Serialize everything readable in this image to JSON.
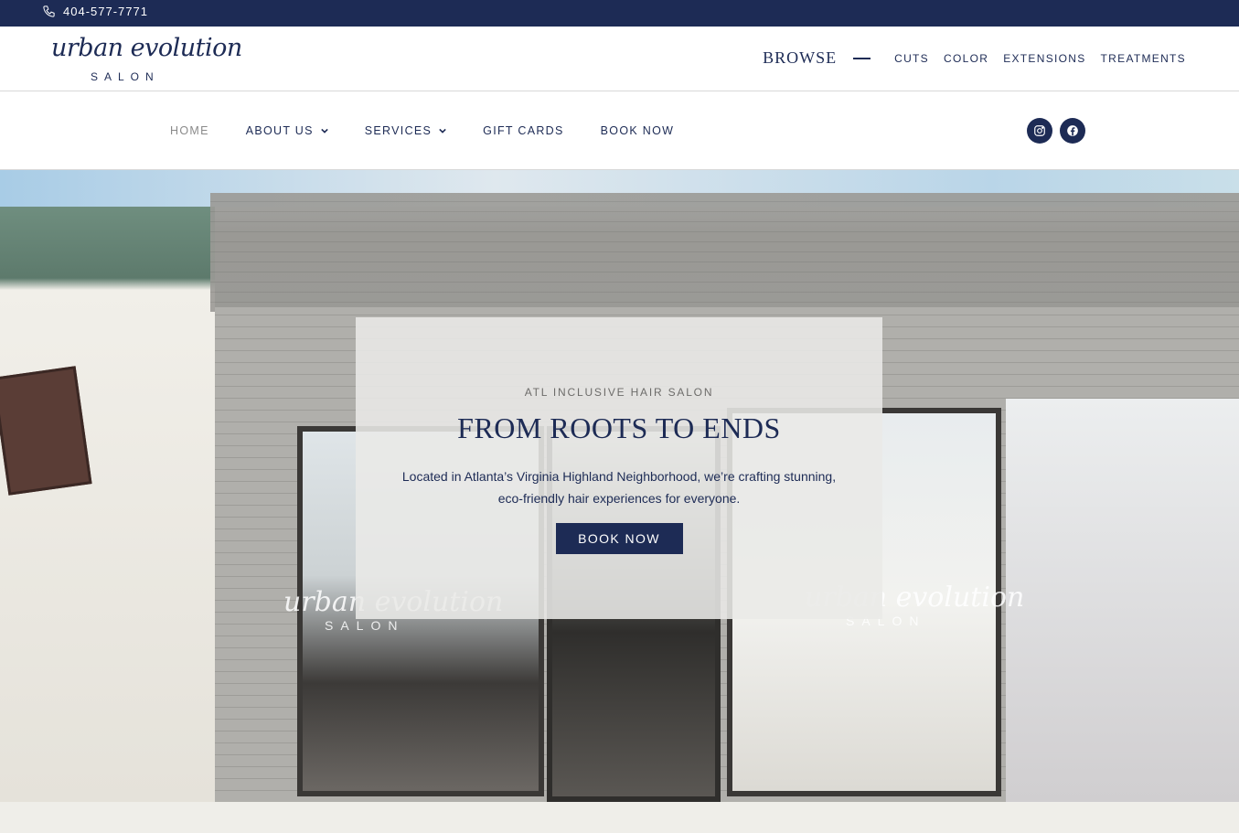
{
  "topbar": {
    "phone": "404-577-7771",
    "phone_icon": "phone-icon"
  },
  "logo": {
    "script": "urban evolution",
    "subtitle": "SALON"
  },
  "browse": {
    "label": "BROWSE",
    "items": [
      "CUTS",
      "COLOR",
      "EXTENSIONS",
      "TREATMENTS"
    ]
  },
  "nav": {
    "items": [
      {
        "label": "HOME",
        "active": true,
        "dropdown": false
      },
      {
        "label": "ABOUT US",
        "active": false,
        "dropdown": true
      },
      {
        "label": "SERVICES",
        "active": false,
        "dropdown": true
      },
      {
        "label": "GIFT CARDS",
        "active": false,
        "dropdown": false
      },
      {
        "label": "BOOK NOW",
        "active": false,
        "dropdown": false
      }
    ],
    "social": [
      "instagram-icon",
      "facebook-icon"
    ]
  },
  "hero": {
    "eyebrow": "ATL INCLUSIVE HAIR SALON",
    "title": "FROM ROOTS TO ENDS",
    "description": "Located in Atlanta’s Virginia Highland Neighborhood, we’re crafting stunning, eco-friendly hair experiences for everyone.",
    "button": "BOOK NOW",
    "window_logo": "urban evolution",
    "window_logo_sub": "SALON"
  },
  "colors": {
    "brand": "#1d2b55",
    "background": "#efeee9",
    "muted": "#8a8a8a"
  }
}
